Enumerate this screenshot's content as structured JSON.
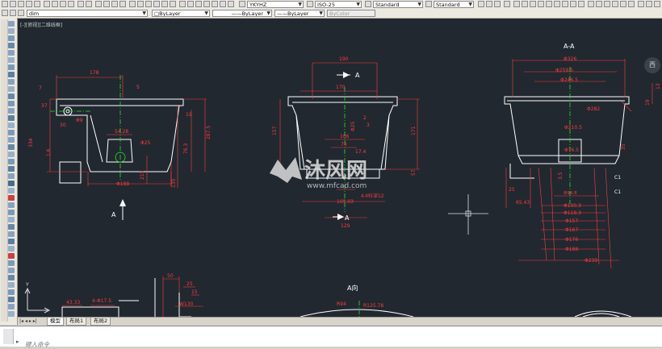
{
  "toolbar_top": {
    "layer_combo": "dim",
    "text_style": "YKYHZ",
    "dim_style": "ISO-25",
    "table_style": "Standard",
    "multileader_style": "Standard"
  },
  "toolbar_props": {
    "color": "ByLayer",
    "linetype": "ByLayer",
    "lineweight": "ByLayer",
    "plotstyle": "ByColor"
  },
  "viewport": {
    "title": "[-][俯视][二维线框]",
    "view_label": "西"
  },
  "drawing": {
    "watermark_name": "沐风网",
    "watermark_url": "www.mfcad.com",
    "front_view": {
      "d178": "178",
      "d7": "7",
      "d37": "37",
      "d30": "30",
      "d5": "5",
      "phi9": "Φ9",
      "d54_28": "54.28",
      "phi25": "Φ25",
      "d287_5": "287.5",
      "d334": "334",
      "d76_3": "76.3",
      "d1_6": "1.6",
      "d135": "135",
      "d215": "215",
      "phi188": "Φ188",
      "d19": "19",
      "section_label": "A"
    },
    "mid_view": {
      "d190": "190",
      "d170": "170",
      "section_label_top": "A",
      "d157": "157",
      "d171": "171",
      "phi25": "Φ25",
      "d2": "2",
      "d3": "3",
      "d106": "106",
      "d74": "74",
      "d17_4": "17.4",
      "d57": "57",
      "d4_M5": "4-M5深12",
      "d105_03": "105.03",
      "d129": "129",
      "section_label_bot": "A"
    },
    "section_view": {
      "title": "A-A",
      "phi326": "Φ326",
      "phi259": "Φ259.5",
      "phi246": "Φ246.5",
      "phi282": "Φ282",
      "phi210": "Φ210.5",
      "phi76": "Φ76.5",
      "d13": "13",
      "d19": "19",
      "d166": "166",
      "d35": "35",
      "d3_5": "3.5",
      "c1a": "C1",
      "c1b": "C1",
      "d25": "25",
      "d65_43": "65.43",
      "phi94": "Φ94.8",
      "phi100": "Φ100.3",
      "phi118": "Φ118.3",
      "phi157": "Φ157",
      "phi167": "Φ167",
      "phi176": "Φ176",
      "phi188": "Φ188",
      "phi239": "Φ239"
    },
    "bottom_left": {
      "d43_33": "43.33",
      "d4_17_5": "4-Φ17.5"
    },
    "bottom_mid": {
      "d50": "50",
      "d25": "25",
      "d15": "15",
      "w130": "W130"
    },
    "bottom_right": {
      "title": "A向",
      "r94": "R94",
      "r125_78": "R125.78"
    }
  },
  "layout_tabs": [
    "模型",
    "布局1",
    "布局2"
  ],
  "command_line": {
    "placeholder": "键入命令"
  },
  "colors": {
    "canvas": "#212830",
    "dim_red": "#ff3b3b",
    "dim_green": "#28e028",
    "outline_white": "#ffffff",
    "center_line": "#00ff40"
  }
}
